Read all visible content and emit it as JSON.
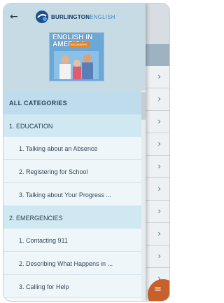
{
  "header": {
    "logo_text_main": "BURLINGTON",
    "logo_text_accent": "ENGLISH",
    "search_icon": "search-icon",
    "back_icon": "arrow-left-icon"
  },
  "course": {
    "title_line1": "ENGLISH IN",
    "title_line2": "AMERICA",
    "badge": "BEGINNERS"
  },
  "categories": {
    "all": "ALL CATEGORIES",
    "education": {
      "label": "1. EDUCATION",
      "items": [
        "1. Talking about an Absence",
        "2. Registering for School",
        "3. Talking about Your Progress ..."
      ]
    },
    "emergencies": {
      "label": "2. EMERGENCIES",
      "items": [
        "1. Contacting 911",
        "2. Describing What Happens in ...",
        "3. Calling for Help"
      ]
    }
  },
  "colors": {
    "accent": "#c8602b",
    "header_bg": "#c6dbe4",
    "category_bg": "#cfe8f1",
    "all_bg": "#bfdcec"
  }
}
